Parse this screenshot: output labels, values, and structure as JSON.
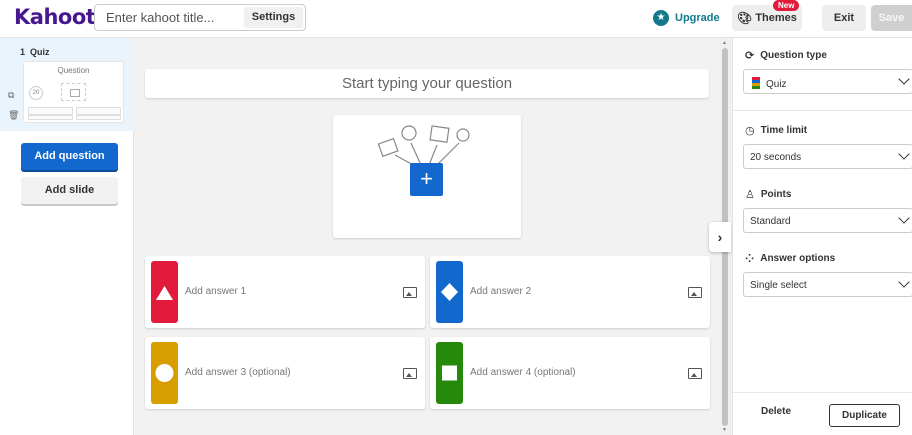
{
  "header": {
    "logo": "Kahoot!",
    "title_placeholder": "Enter kahoot title...",
    "settings_label": "Settings",
    "upgrade_label": "Upgrade",
    "themes_label": "Themes",
    "new_badge": "New",
    "exit_label": "Exit",
    "save_label": "Save"
  },
  "sidebar": {
    "slides": [
      {
        "number": "1",
        "type": "Quiz",
        "thumb_title": "Question",
        "thumb_timer": "20"
      }
    ],
    "add_question_label": "Add question",
    "add_slide_label": "Add slide"
  },
  "editor": {
    "question_placeholder": "Start typing your question",
    "answers": [
      {
        "placeholder": "Add answer 1",
        "shape": "triangle",
        "color": "#e21b3c"
      },
      {
        "placeholder": "Add answer 2",
        "shape": "diamond",
        "color": "#1368ce"
      },
      {
        "placeholder": "Add answer 3 (optional)",
        "shape": "circle",
        "color": "#d89e00"
      },
      {
        "placeholder": "Add answer 4 (optional)",
        "shape": "square",
        "color": "#26890c"
      }
    ]
  },
  "settings_panel": {
    "question_type": {
      "label": "Question type",
      "value": "Quiz"
    },
    "time_limit": {
      "label": "Time limit",
      "value": "20 seconds"
    },
    "points": {
      "label": "Points",
      "value": "Standard"
    },
    "answer_options": {
      "label": "Answer options",
      "value": "Single select"
    },
    "delete_label": "Delete",
    "duplicate_label": "Duplicate"
  },
  "colors": {
    "brand": "#46178f",
    "primary_button": "#1368ce",
    "upgrade": "#127a8c"
  }
}
